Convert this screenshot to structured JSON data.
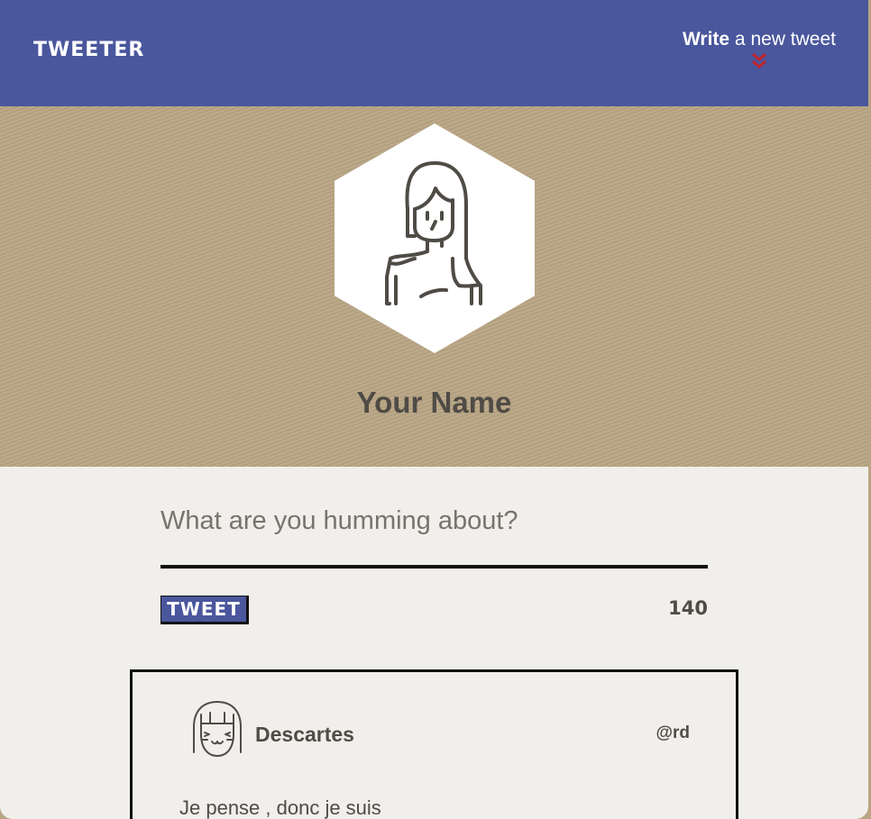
{
  "nav": {
    "brand": "TWEETER",
    "compose_bold": "Write",
    "compose_rest": " a new tweet",
    "compose_icon": "double-chevron-down-icon",
    "accent_color": "#c0232b"
  },
  "profile": {
    "name": "Your Name",
    "avatar_icon": "woman-avatar-icon"
  },
  "composer": {
    "placeholder": "What are you humming about?",
    "tweet_button": "TWEET",
    "char_count": "140"
  },
  "tweets": [
    {
      "author": "Descartes",
      "handle": "@rd",
      "body": "Je pense , donc je suis",
      "avatar_icon": "smiling-face-avatar-icon"
    }
  ],
  "colors": {
    "nav_bg": "#4a579d",
    "hero_bg": "#b9a584",
    "page_bg": "#f1efeb",
    "text": "#4f4b45"
  }
}
